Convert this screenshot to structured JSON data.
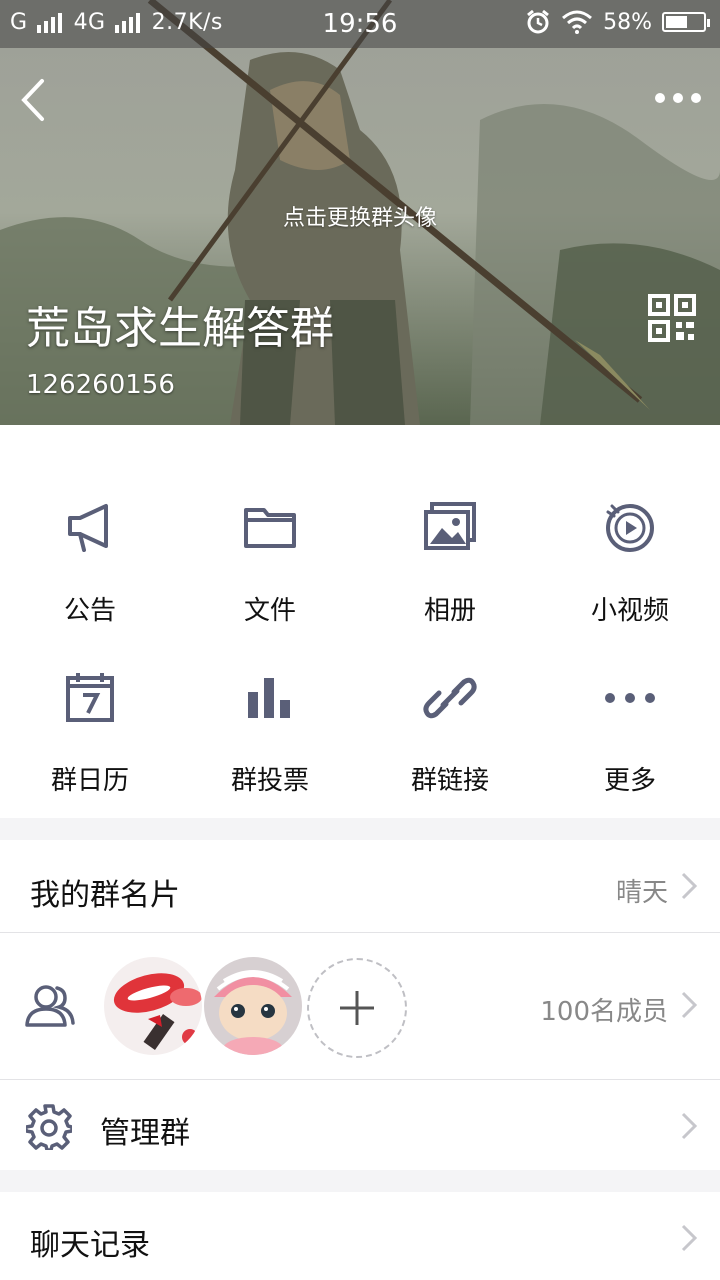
{
  "status_bar": {
    "carrier1": "G",
    "carrier2": "4G",
    "speed": "2.7K/s",
    "time": "19:56",
    "battery_text": "58%",
    "battery_level": 0.58
  },
  "header": {
    "change_avatar_text": "点击更换群头像",
    "group_name": "荒岛求生解答群",
    "group_id": "126260156"
  },
  "grid": {
    "items": [
      {
        "label": "公告",
        "icon": "megaphone-icon"
      },
      {
        "label": "文件",
        "icon": "folder-icon"
      },
      {
        "label": "相册",
        "icon": "album-icon"
      },
      {
        "label": "小视频",
        "icon": "video-icon"
      },
      {
        "label": "群日历",
        "icon": "calendar-icon"
      },
      {
        "label": "群投票",
        "icon": "vote-chart-icon"
      },
      {
        "label": "群链接",
        "icon": "link-icon"
      },
      {
        "label": "更多",
        "icon": "more-dots-icon"
      }
    ]
  },
  "list": {
    "card_title": "我的群名片",
    "card_value": "晴天",
    "members_value": "100名成员",
    "manage_title": "管理群",
    "chat_history_title": "聊天记录"
  },
  "colors": {
    "icon_color": "#5a5f78",
    "chevron": "#c7c7cc",
    "secondary_text": "#888888"
  }
}
